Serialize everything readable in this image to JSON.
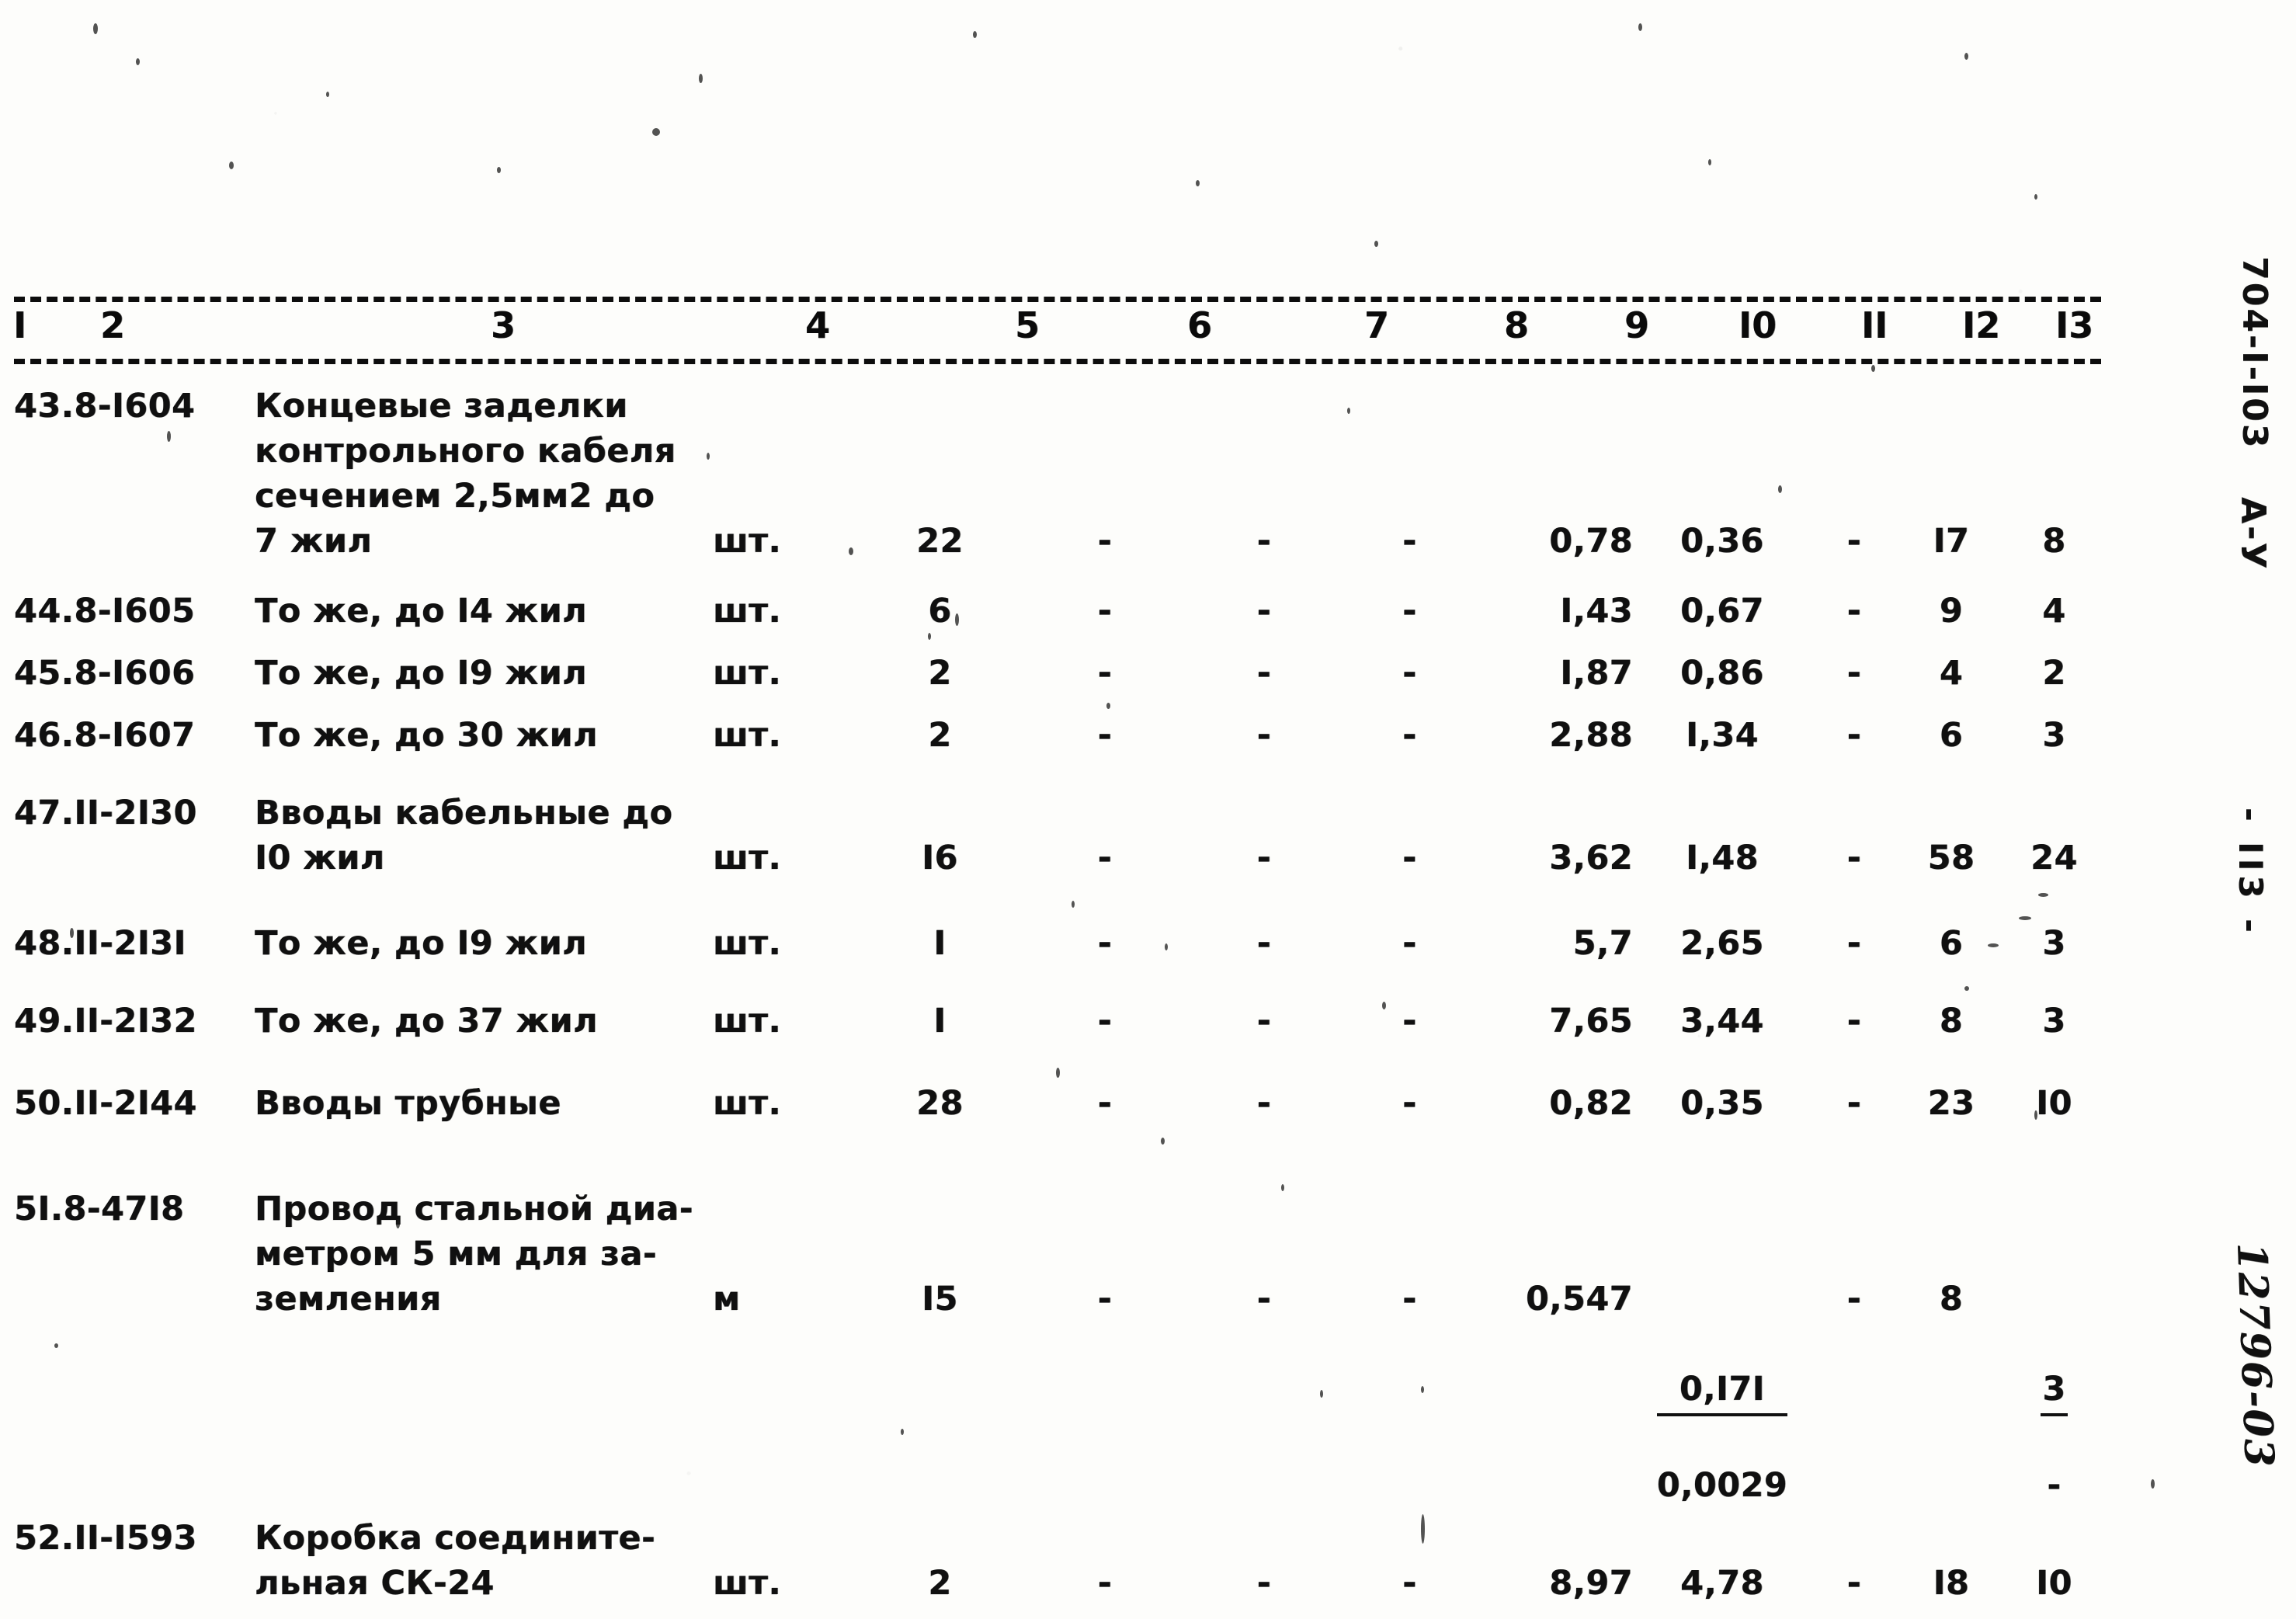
{
  "document": {
    "sheet_code": "704-I-I03",
    "revision_mark": "А-У",
    "page_number": "- II3 -",
    "handwritten_number": "12796-03"
  },
  "table": {
    "column_numbers": [
      "I",
      "2",
      "3",
      "4",
      "5",
      "6",
      "7",
      "8",
      "9",
      "I0",
      "II",
      "I2",
      "I3"
    ],
    "rows": [
      {
        "code": "43.8-I604",
        "description": "Концевые заделки\nконтрольного кабеля\nсечением 2,5мм2 до\n7 жил",
        "unit": "шт.",
        "qty": "22",
        "c6": "-",
        "c7": "-",
        "c8": "-",
        "c9": "0,78",
        "c10": "0,36",
        "c11": "-",
        "c12": "I7",
        "c13": "8"
      },
      {
        "code": "44.8-I605",
        "description": "То же, до I4 жил",
        "unit": "шт.",
        "qty": "6",
        "c6": "-",
        "c7": "-",
        "c8": "-",
        "c9": "I,43",
        "c10": "0,67",
        "c11": "-",
        "c12": "9",
        "c13": "4"
      },
      {
        "code": "45.8-I606",
        "description": "То же, до I9 жил",
        "unit": "шт.",
        "qty": "2",
        "c6": "-",
        "c7": "-",
        "c8": "-",
        "c9": "I,87",
        "c10": "0,86",
        "c11": "-",
        "c12": "4",
        "c13": "2"
      },
      {
        "code": "46.8-I607",
        "description": "То же, до 30 жил",
        "unit": "шт.",
        "qty": "2",
        "c6": "-",
        "c7": "-",
        "c8": "-",
        "c9": "2,88",
        "c10": "I,34",
        "c11": "-",
        "c12": "6",
        "c13": "3"
      },
      {
        "code": "47.II-2I30",
        "description": "Вводы кабельные до\nI0 жил",
        "unit": "шт.",
        "qty": "I6",
        "c6": "-",
        "c7": "-",
        "c8": "-",
        "c9": "3,62",
        "c10": "I,48",
        "c11": "-",
        "c12": "58",
        "c13": "24"
      },
      {
        "code": "48.II-2I3I",
        "description": "То же, до I9 жил",
        "unit": "шт.",
        "qty": "I",
        "c6": "-",
        "c7": "-",
        "c8": "-",
        "c9": "5,7",
        "c10": "2,65",
        "c11": "-",
        "c12": "6",
        "c13": "3"
      },
      {
        "code": "49.II-2I32",
        "description": "То же, до 37 жил",
        "unit": "шт.",
        "qty": "I",
        "c6": "-",
        "c7": "-",
        "c8": "-",
        "c9": "7,65",
        "c10": "3,44",
        "c11": "-",
        "c12": "8",
        "c13": "3"
      },
      {
        "code": "50.II-2I44",
        "description": "Вводы трубные",
        "unit": "шт.",
        "qty": "28",
        "c6": "-",
        "c7": "-",
        "c8": "-",
        "c9": "0,82",
        "c10": "0,35",
        "c11": "-",
        "c12": "23",
        "c13": "I0"
      },
      {
        "code": "5I.8-47I8",
        "description": "Провод стальной диа-\nметром 5 мм для за-\nземления",
        "unit": "м",
        "qty": "I5",
        "c6": "-",
        "c7": "-",
        "c8": "-",
        "c9": "0,547",
        "c10_numerator": "0,I7I",
        "c10_denominator": "0,0029",
        "c11": "-",
        "c12": "8",
        "c13_numerator": "3",
        "c13_denominator": "-"
      },
      {
        "code": "52.II-I593",
        "description": "Коробка соедините-\nльная СК-24",
        "unit": "шт.",
        "qty": "2",
        "c6": "-",
        "c7": "-",
        "c8": "-",
        "c9": "8,97",
        "c10": "4,78",
        "c11": "-",
        "c12": "I8",
        "c13": "I0"
      }
    ]
  }
}
